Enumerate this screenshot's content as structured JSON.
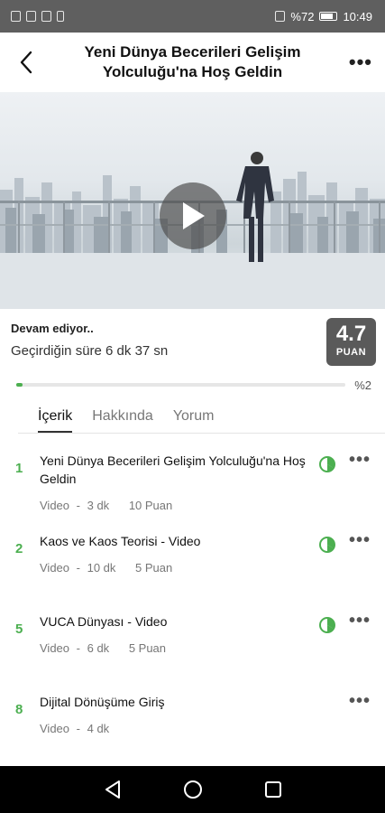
{
  "status_bar": {
    "battery": "%72",
    "time": "10:49"
  },
  "header": {
    "title": "Yeni Dünya Becerileri Gelişim Yolculuğu'na Hoş Geldin"
  },
  "progress": {
    "status": "Devam ediyor..",
    "time_spent": "Geçirdiğin süre 6 dk 37 sn",
    "score": "4.7",
    "score_label": "PUAN",
    "percent_label": "%2",
    "percent": 0.02
  },
  "tabs": [
    {
      "label": "İçerik",
      "active": true
    },
    {
      "label": "Hakkında",
      "active": false
    },
    {
      "label": "Yorum",
      "active": false
    }
  ],
  "items": [
    {
      "number": "1",
      "title": "Yeni Dünya Becerileri Gelişim Yolculuğu'na Hoş Geldin",
      "type": "Video",
      "sep": "-",
      "duration": "3 dk",
      "points": "10 Puan",
      "status_icon": "partial-progress-icon"
    },
    {
      "number": "2",
      "title": "Kaos ve Kaos Teorisi - Video",
      "type": "Video",
      "sep": "-",
      "duration": "10 dk",
      "points": "5 Puan",
      "status_icon": "partial-progress-icon"
    },
    {
      "number": "5",
      "title": "VUCA Dünyası - Video",
      "type": "Video",
      "sep": "-",
      "duration": "6 dk",
      "points": "5 Puan",
      "status_icon": "partial-progress-icon"
    },
    {
      "number": "8",
      "title": "Dijital Dönüşüme Giriş",
      "type": "Video",
      "sep": "-",
      "duration": "4 dk",
      "points": ""
    }
  ],
  "colors": {
    "accent": "#4caf50",
    "score_badge": "#5a5a5a",
    "status_bar": "#5f5f5f"
  }
}
